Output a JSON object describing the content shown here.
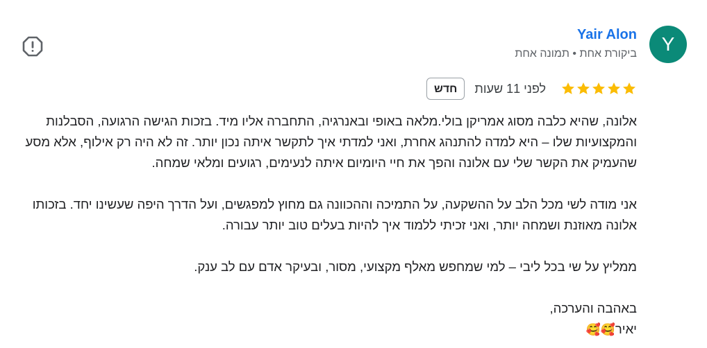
{
  "reviewer": {
    "avatar_letter": "Y",
    "avatar_color": "#0b8a78",
    "name": "Yair Alon",
    "meta": "ביקורת אחת • תמונה אחת"
  },
  "review": {
    "rating": 5,
    "time": "לפני 11 שעות",
    "badge": "חדש",
    "paragraphs": [
      "אלונה, שהיא כלבה מסוג אמריקן בולי.מלאה באופי ובאנרגיה, התחברה אליו מיד. בזכות הגישה הרגועה, הסבלנות והמקצועיות שלו – היא למדה להתנהג אחרת, ואני למדתי איך לתקשר איתה נכון יותר. זה לא היה רק אילוף, אלא מסע שהעמיק את הקשר שלי עם אלונה והפך את חיי היומיום איתה לנעימים, רגועים ומלאי שמחה.",
      "אני מודה לשי מכל הלב על ההשקעה, על התמיכה וההכוונה גם מחוץ למפגשים, ועל הדרך היפה שעשינו יחד. בזכותו אלונה מאוזנת ושמחה יותר, ואני זכיתי ללמוד איך להיות בעלים טוב יותר עבורה.",
      "ממליץ על שי בכל ליבי – למי שמחפש מאלף מקצועי, מסור, ובעיקר אדם עם לב ענק."
    ],
    "closing": "באהבה והערכה,",
    "signature": "יאיר",
    "signature_emoji": "🥰🥰"
  },
  "icons": {
    "flag": "report-flag-icon",
    "star": "star-icon",
    "star_color": "#fbbc04"
  }
}
